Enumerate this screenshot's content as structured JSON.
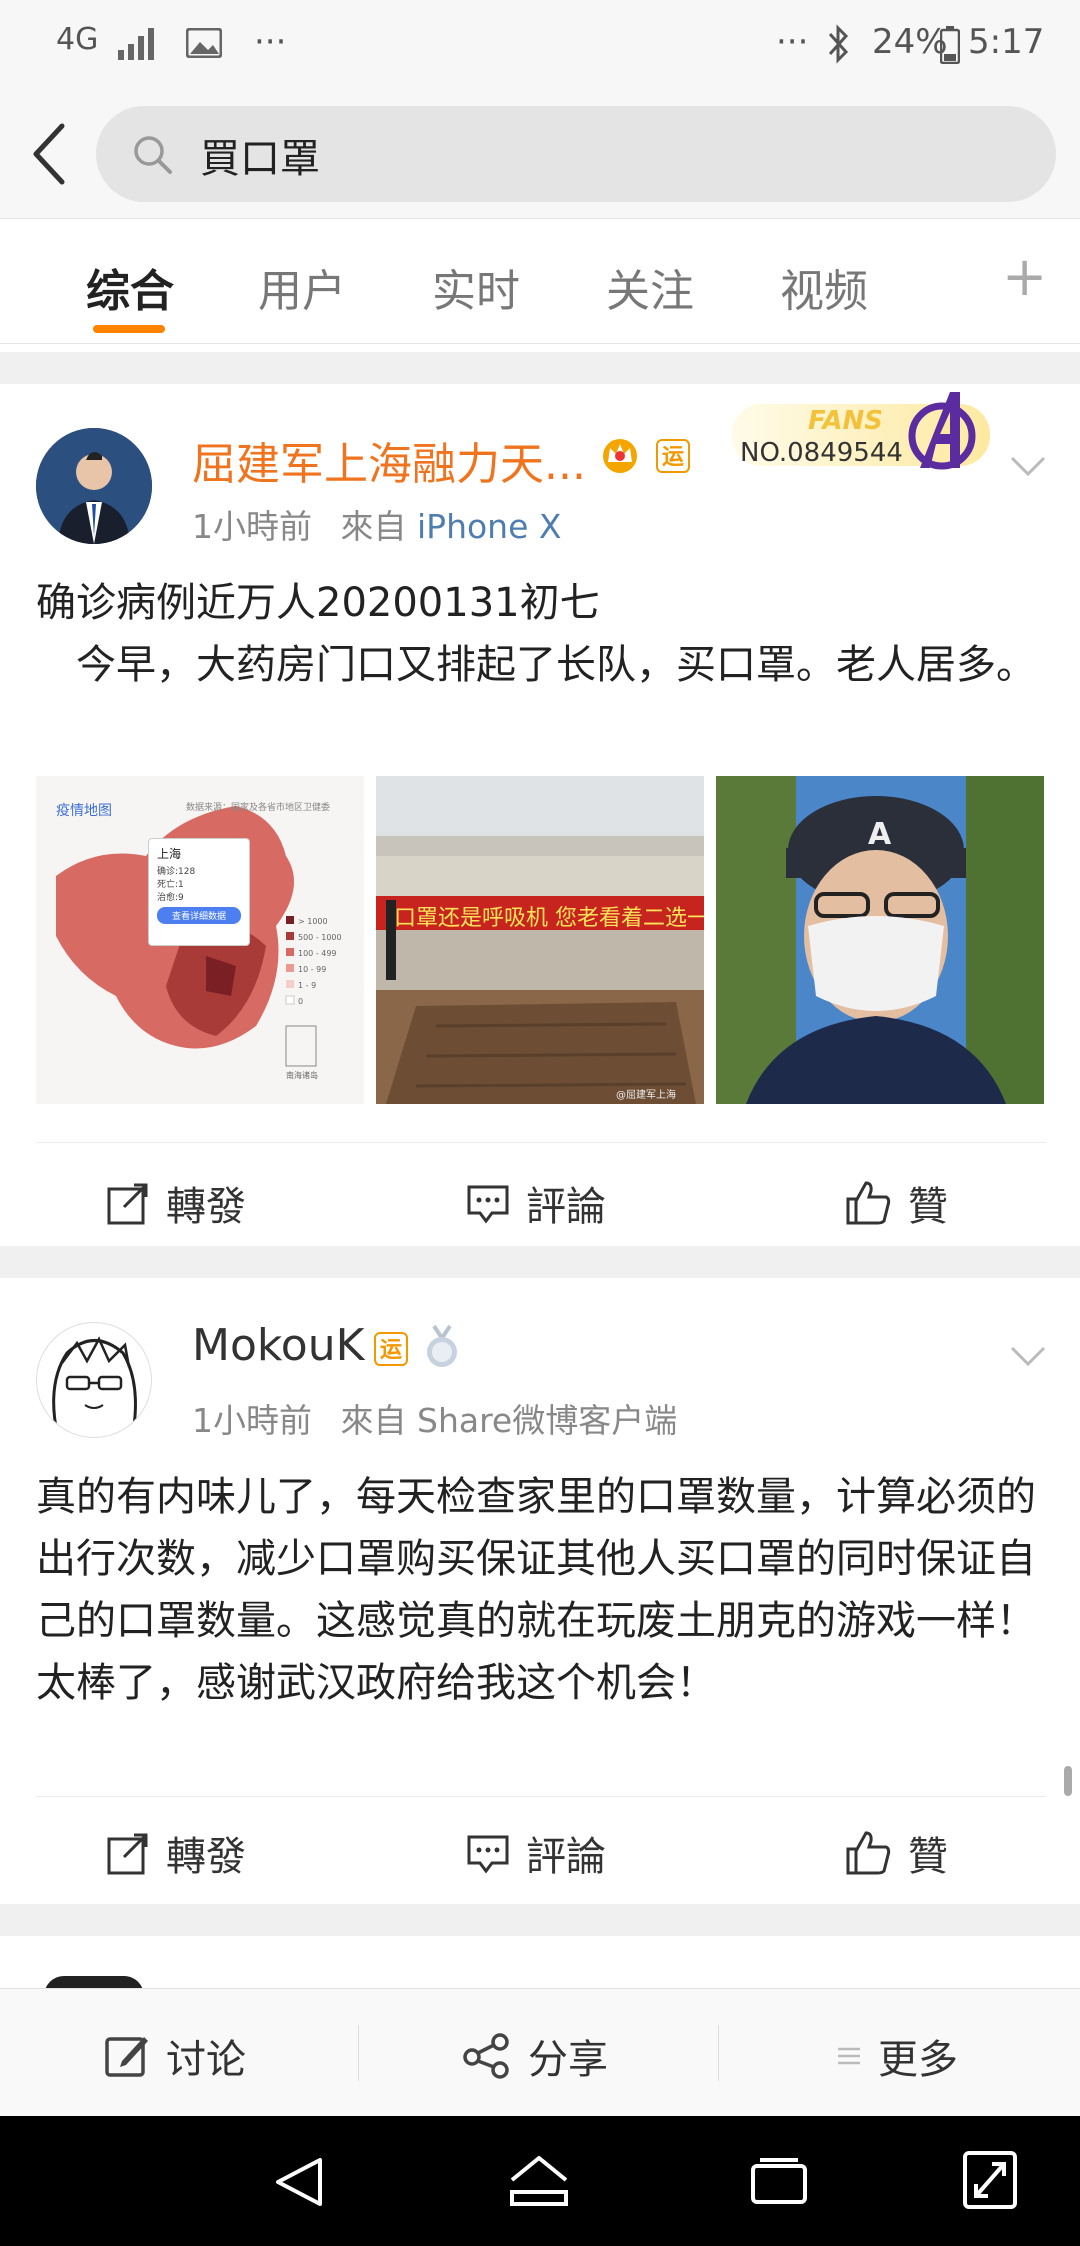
{
  "status": {
    "network": "4G",
    "battery": "24%",
    "time": "5:17",
    "more_left": "···",
    "more_right": "···"
  },
  "search": {
    "query": "買口罩"
  },
  "tabs": [
    {
      "label": "综合"
    },
    {
      "label": "用户"
    },
    {
      "label": "实时"
    },
    {
      "label": "关注"
    },
    {
      "label": "视频"
    }
  ],
  "tab_add": "+",
  "posts": [
    {
      "author": "屈建军上海融力天...",
      "time": "1小時前",
      "from_label": "來自",
      "source": "iPhone X",
      "fans_label": "FANS",
      "fans_no": "NO.0849544",
      "text": "确诊病例近万人20200131初七\n　今早，大药房门口又排起了长队，买口罩。老人居多。",
      "map": {
        "title": "疫情地图",
        "source": "数据来源：国家及各省市地区卫健委",
        "popup_city": "上海",
        "popup_lines": [
          "确诊:128",
          "死亡:1",
          "治愈:9"
        ],
        "popup_button": "查看详细数据",
        "legend": [
          "> 1000",
          "500 - 1000",
          "100 - 499",
          "10 - 99",
          "1 - 9",
          "0"
        ],
        "island_label": "南海诸岛"
      },
      "banner_text": "口罩还是呼吸机 您老看着二选一",
      "watermark": "@屈建军上海",
      "actions": {
        "repost": "轉發",
        "comment": "評論",
        "like": "贊"
      }
    },
    {
      "author": "MokouK",
      "time": "1小時前",
      "from_label": "來自",
      "source": "Share微博客户端",
      "text": "真的有内味儿了，每天检查家里的口罩数量，计算必须的出行次数，减少口罩购买保证其他人买口罩的同时保证自己的口罩数量。这感觉真的就在玩废土朋克的游戏一样！太棒了，感谢武汉政府给我这个机会！",
      "actions": {
        "repost": "轉發",
        "comment": "評論",
        "like": "贊"
      }
    }
  ],
  "bottom": {
    "discuss": "讨论",
    "share": "分享",
    "more": "更多"
  },
  "colors": {
    "accent": "#ff8200",
    "link": "#507daf",
    "author": "#f0731e"
  }
}
